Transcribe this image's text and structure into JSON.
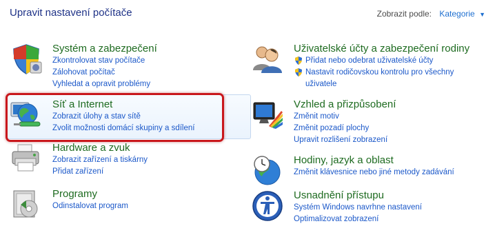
{
  "header": {
    "title": "Upravit nastavení počítače",
    "view_by_label": "Zobrazit podle:",
    "view_by_value": "Kategorie"
  },
  "left": [
    {
      "title": "Systém a zabezpečení",
      "icon": "shield-icon",
      "links": [
        "Zkontrolovat stav počítače",
        "Zálohovat počítač",
        "Vyhledat a opravit problémy"
      ]
    },
    {
      "title": "Síť a Internet",
      "icon": "globe-network-icon",
      "links": [
        "Zobrazit úlohy a stav sítě",
        "Zvolit možnosti domácí skupiny a sdílení"
      ]
    },
    {
      "title": "Hardware a zvuk",
      "icon": "printer-icon",
      "links": [
        "Zobrazit zařízení a tiskárny",
        "Přidat zařízení"
      ]
    },
    {
      "title": "Programy",
      "icon": "programs-icon",
      "links": [
        "Odinstalovat program"
      ]
    }
  ],
  "right": [
    {
      "title": "Uživatelské účty a zabezpečení rodiny",
      "icon": "users-icon",
      "links": [
        "Přidat nebo odebrat uživatelské účty",
        "Nastavit rodičovskou kontrolu pro všechny",
        "uživatele"
      ]
    },
    {
      "title": "Vzhled a přizpůsobení",
      "icon": "monitor-appearance-icon",
      "links": [
        "Změnit motiv",
        "Změnit pozadí plochy",
        "Upravit rozlišení zobrazení"
      ]
    },
    {
      "title": "Hodiny, jazyk a oblast",
      "icon": "clock-globe-icon",
      "links": [
        "Změnit klávesnice nebo jiné metody zadávání"
      ]
    },
    {
      "title": "Usnadnění přístupu",
      "icon": "accessibility-icon",
      "links": [
        "Systém Windows navrhne nastavení",
        "Optimalizovat zobrazení"
      ]
    }
  ],
  "colors": {
    "title_green": "#1e6b20",
    "link_blue": "#1b58c9",
    "highlight_red": "#c9171c"
  }
}
